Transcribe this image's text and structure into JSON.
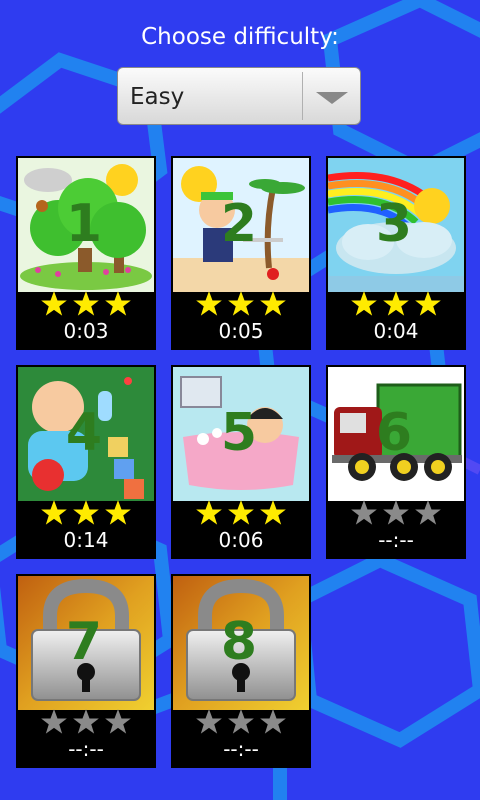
{
  "header": {
    "title": "Choose difficulty:"
  },
  "difficulty_select": {
    "selected": "Easy"
  },
  "colors": {
    "background": "#2f3cf0",
    "star_earned": "#ffeb00",
    "star_empty": "#8a8a8a",
    "level_number": "#2e7d1f"
  },
  "levels": [
    {
      "number": "1",
      "time": "0:03",
      "stars": 3,
      "locked": false,
      "theme": "trees"
    },
    {
      "number": "2",
      "time": "0:05",
      "stars": 3,
      "locked": false,
      "theme": "pirate"
    },
    {
      "number": "3",
      "time": "0:04",
      "stars": 3,
      "locked": false,
      "theme": "rainbow"
    },
    {
      "number": "4",
      "time": "0:14",
      "stars": 3,
      "locked": false,
      "theme": "baby"
    },
    {
      "number": "5",
      "time": "0:06",
      "stars": 3,
      "locked": false,
      "theme": "bath"
    },
    {
      "number": "6",
      "time": "--:--",
      "stars": 0,
      "locked": false,
      "theme": "truck"
    },
    {
      "number": "7",
      "time": "--:--",
      "stars": 0,
      "locked": true,
      "theme": "padlock"
    },
    {
      "number": "8",
      "time": "--:--",
      "stars": 0,
      "locked": true,
      "theme": "padlock"
    }
  ]
}
